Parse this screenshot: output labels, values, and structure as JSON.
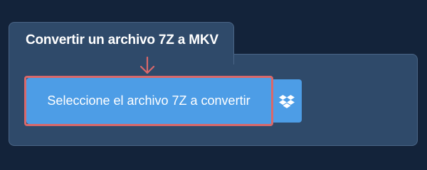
{
  "converter": {
    "title": "Convertir un archivo 7Z a MKV",
    "select_button_label": "Seleccione el archivo 7Z a convertir",
    "dropbox_icon": "dropbox-icon",
    "pointer_icon": "arrow-down-icon"
  },
  "colors": {
    "background": "#13233a",
    "panel": "#2f4a6a",
    "button": "#4d9de6",
    "highlight": "#d9686a"
  }
}
